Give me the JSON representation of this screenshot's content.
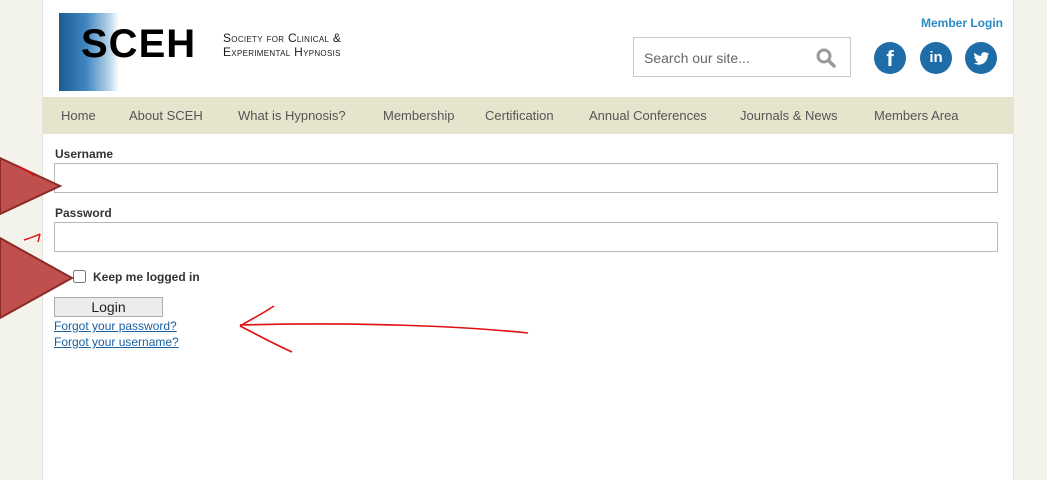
{
  "header": {
    "logo_text": "SCEH",
    "logo_tagline": "Society for Clinical &\nExperimental Hypnosis",
    "member_login": "Member Login"
  },
  "search": {
    "placeholder": "Search our site..."
  },
  "social": {
    "facebook_glyph": "f",
    "linkedin_glyph": "in"
  },
  "nav": {
    "items": [
      {
        "label": "Home"
      },
      {
        "label": "About SCEH"
      },
      {
        "label": "What is Hypnosis?"
      },
      {
        "label": "Membership"
      },
      {
        "label": "Certification"
      },
      {
        "label": "Annual Conferences"
      },
      {
        "label": "Journals & News"
      },
      {
        "label": "Members Area"
      }
    ]
  },
  "form": {
    "username_label": "Username",
    "username_value": "",
    "password_label": "Password",
    "password_value": "",
    "remember_label": "Keep me logged in",
    "login_button": "Login",
    "forgot_password": "Forgot your password?",
    "forgot_username": "Forgot your username?"
  },
  "colors": {
    "nav_background": "#e7e4ce",
    "link": "#1a5fa3",
    "accent_blue": "#1e6ca8",
    "annotation_red": "#e01010",
    "annotation_arrow_fill": "#c0504d"
  }
}
